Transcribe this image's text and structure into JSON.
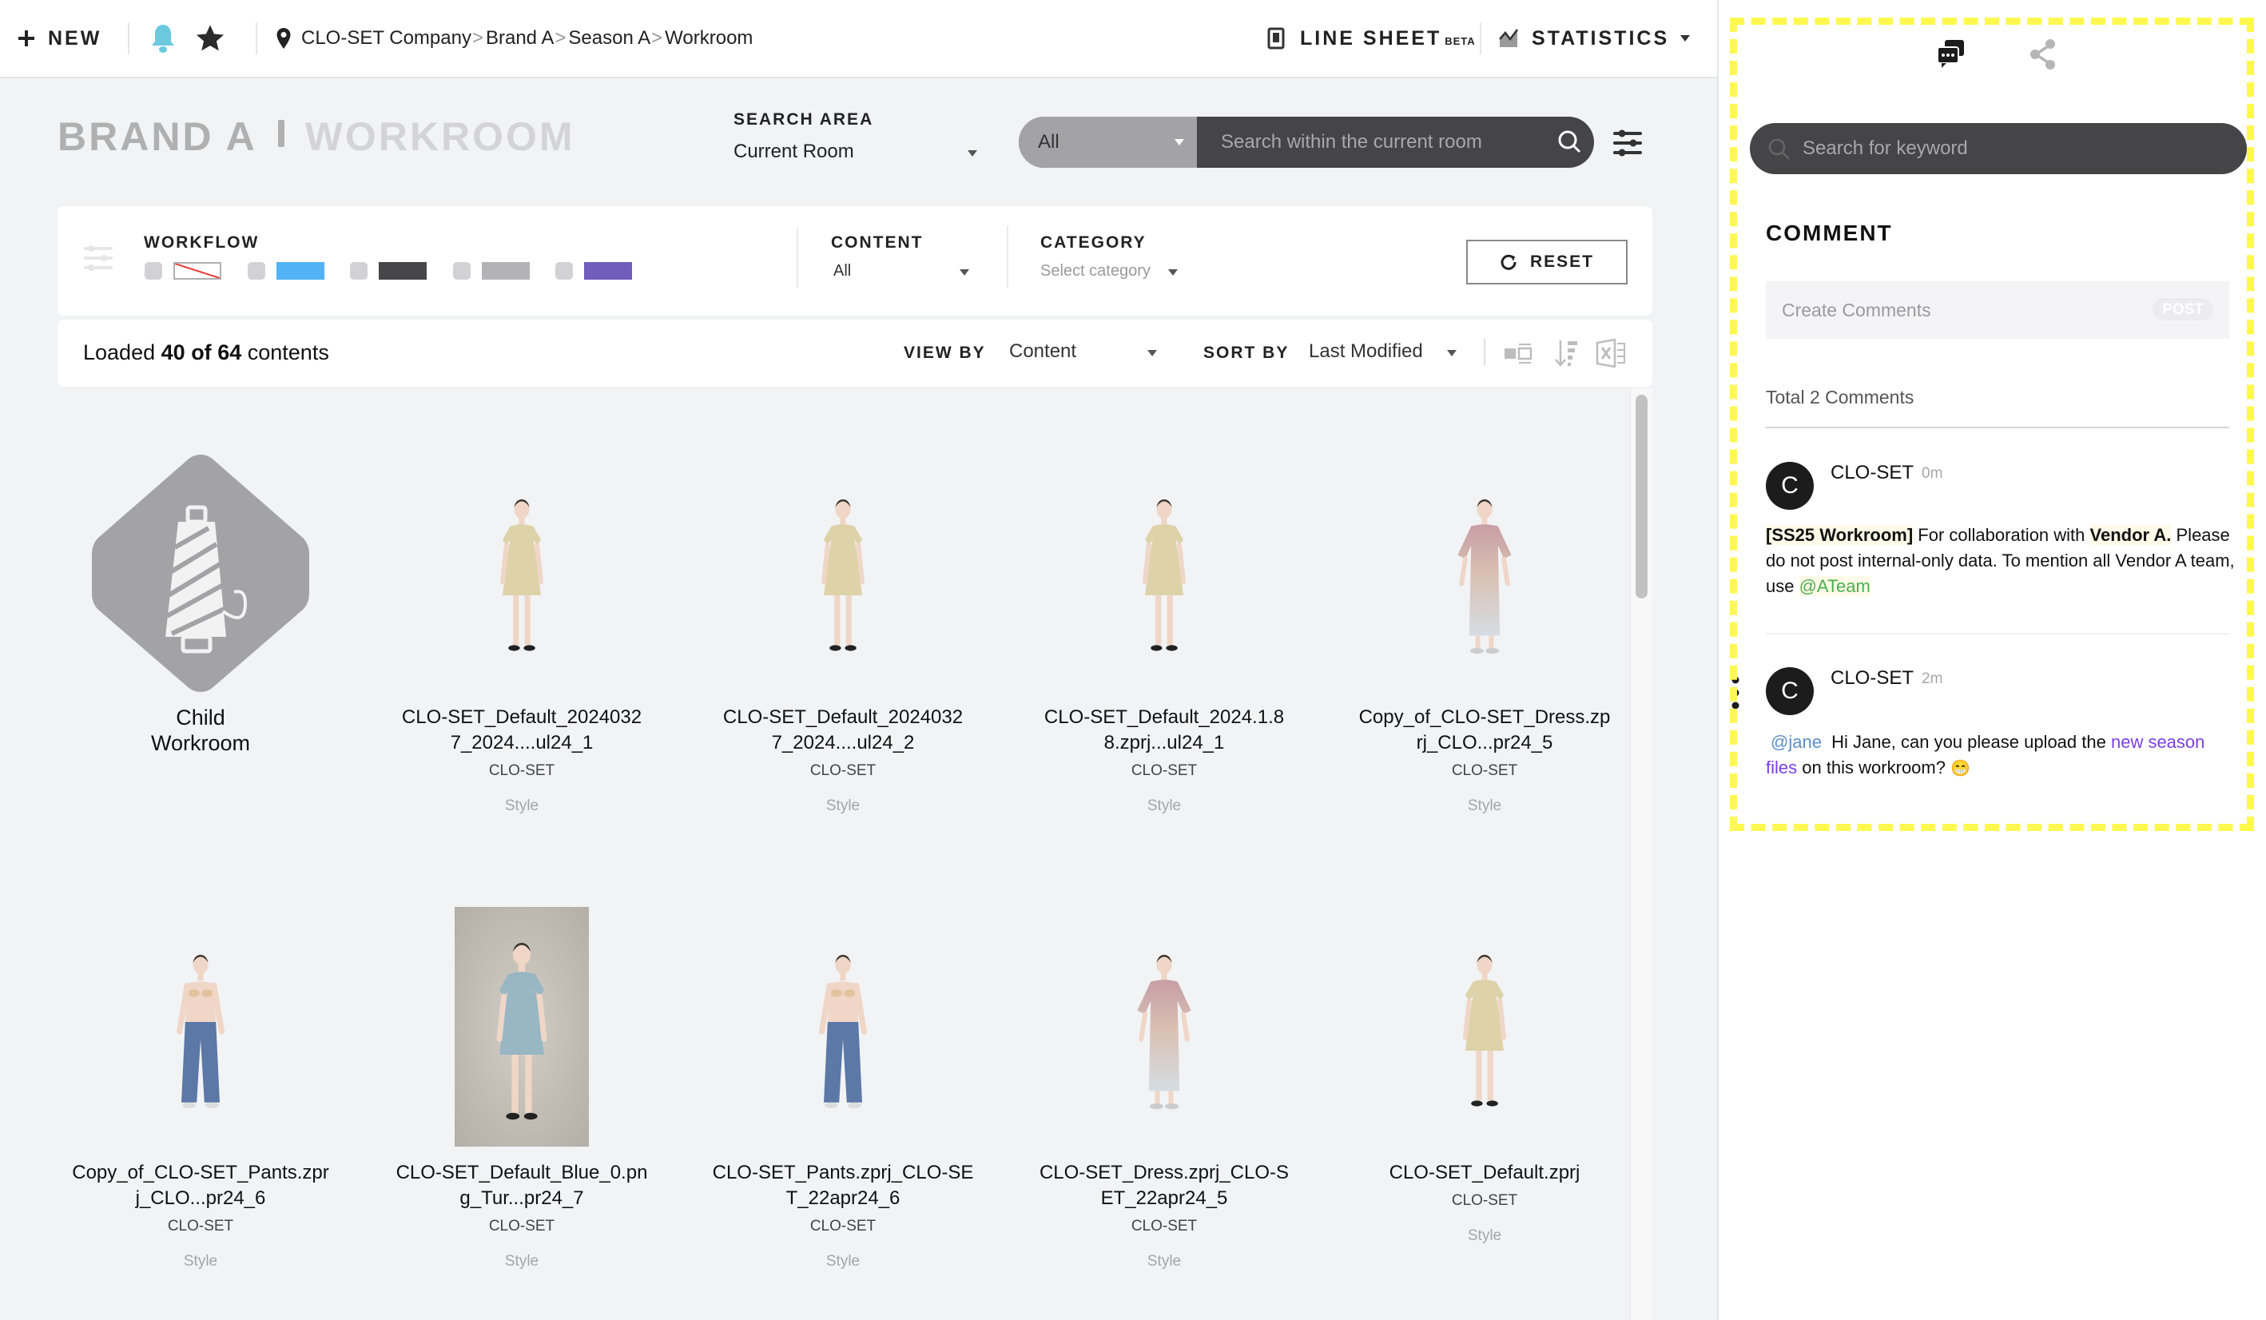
{
  "topbar": {
    "new_label": "NEW",
    "breadcrumb": [
      "CLO-SET Company",
      "Brand A",
      "Season A",
      "Workroom"
    ],
    "line_sheet_label": "LINE SHEET",
    "line_sheet_badge": "BETA",
    "statistics_label": "STATISTICS"
  },
  "header": {
    "brand": "BRAND A",
    "room": "WORKROOM",
    "search_area_label": "SEARCH AREA",
    "search_area_value": "Current Room",
    "search_scope": "All",
    "search_placeholder": "Search within the current room"
  },
  "filters": {
    "workflow_label": "WORKFLOW",
    "workflow_colors": [
      "none",
      "#52b1f7",
      "#47474a",
      "#b3b3b5",
      "#715dbb"
    ],
    "content_label": "CONTENT",
    "content_value": "All",
    "category_label": "CATEGORY",
    "category_placeholder": "Select category",
    "reset_label": "RESET"
  },
  "listbar": {
    "loaded_prefix": "Loaded",
    "loaded_count": "40",
    "loaded_of": "of",
    "total_count": "64",
    "loaded_suffix": "contents",
    "view_by_label": "VIEW BY",
    "view_by_value": "Content",
    "sort_by_label": "SORT BY",
    "sort_by_value": "Last Modified"
  },
  "items": [
    {
      "name": "Child Workroom",
      "kind": "workroom"
    },
    {
      "name": "CLO-SET_Default_2024032 7_2024....ul24_1",
      "owner": "CLO-SET",
      "type": "Style",
      "thumb": "dress-yellow"
    },
    {
      "name": "CLO-SET_Default_2024032 7_2024....ul24_2",
      "owner": "CLO-SET",
      "type": "Style",
      "thumb": "dress-yellow"
    },
    {
      "name": "CLO-SET_Default_2024.1.8 8.zprj...ul24_1",
      "owner": "CLO-SET",
      "type": "Style",
      "thumb": "dress-yellow"
    },
    {
      "name": "Copy_of_CLO-SET_Dress.zp rj_CLO...pr24_5",
      "owner": "CLO-SET",
      "type": "Style",
      "thumb": "dress-gradient"
    },
    {
      "name": "Copy_of_CLO-SET_Pants.zpr j_CLO...pr24_6",
      "owner": "CLO-SET",
      "type": "Style",
      "thumb": "jeans"
    },
    {
      "name": "CLO-SET_Default_Blue_0.pn g_Tur...pr24_7",
      "owner": "CLO-SET",
      "type": "Style",
      "thumb": "dress-blue-photo"
    },
    {
      "name": "CLO-SET_Pants.zprj_CLO-SE T_22apr24_6",
      "owner": "CLO-SET",
      "type": "Style",
      "thumb": "jeans"
    },
    {
      "name": "CLO-SET_Dress.zprj_CLO-S ET_22apr24_5",
      "owner": "CLO-SET",
      "type": "Style",
      "thumb": "dress-gradient"
    },
    {
      "name": "CLO-SET_Default.zprj",
      "owner": "CLO-SET",
      "type": "Style",
      "thumb": "dress-yellow"
    }
  ],
  "panel": {
    "keyword_placeholder": "Search for keyword",
    "comment_title": "COMMENT",
    "create_placeholder": "Create Comments",
    "post_label": "POST",
    "total_label": "Total 2 Comments",
    "comments": [
      {
        "avatar": "C",
        "author": "CLO-SET",
        "time": "0m",
        "tag": "[SS25 Workroom]",
        "text1": " For collaboration with ",
        "bold": "Vendor A.",
        "text2": " Please do not post internal-only data. To mention all Vendor A team, use ",
        "mention": "@ATeam"
      },
      {
        "avatar": "C",
        "author": "CLO-SET",
        "time": "2m",
        "mention": "@jane",
        "text1": "  Hi Jane, can you please upload the ",
        "link": "new season files",
        "text2": " on this workroom? ",
        "emoji": "😁"
      }
    ]
  },
  "colors": {
    "accent_bell": "#6cc9de",
    "mention_green": "#4caf50",
    "mention_blue": "#5b8fc6",
    "link_purple": "#7b3fe4",
    "highlight": "#fff84f"
  }
}
